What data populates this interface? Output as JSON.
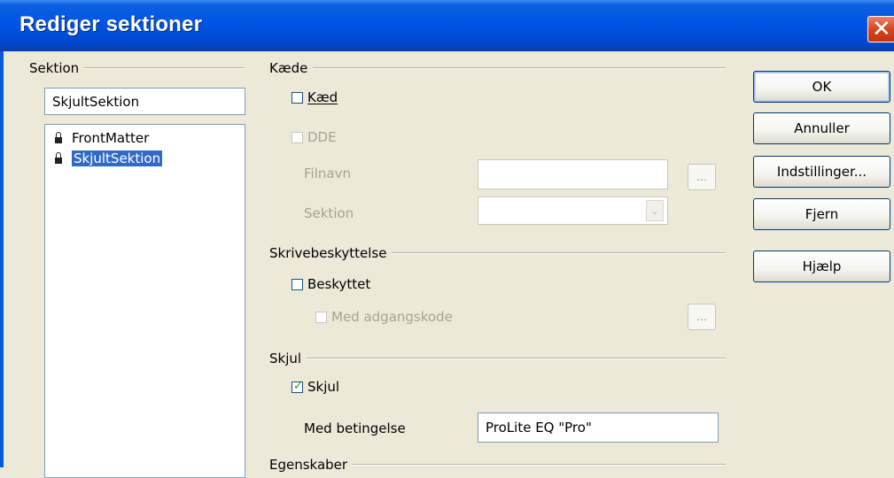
{
  "window": {
    "title": "Rediger sektioner",
    "close_glyph": "✕"
  },
  "section_group": {
    "label": "Sektion",
    "name_value": "SkjultSektion",
    "items": [
      {
        "label": "FrontMatter",
        "icon": "lock-icon",
        "selected": false
      },
      {
        "label": "SkjultSektion",
        "icon": "lock-icon",
        "selected": true
      }
    ]
  },
  "link_group": {
    "label": "Kæde",
    "link_checkbox": {
      "label": "Kæd",
      "checked": false
    },
    "dde_checkbox": {
      "label": "DDE",
      "checked": false,
      "enabled": false
    },
    "filename_label": "Filnavn",
    "filename_value": "",
    "browse_label": "...",
    "section_label": "Sektion",
    "section_value": ""
  },
  "protect_group": {
    "label": "Skrivebeskyttelse",
    "protected_checkbox": {
      "label": "Beskyttet",
      "checked": false
    },
    "password_checkbox": {
      "label": "Med adgangskode",
      "checked": false,
      "enabled": false
    },
    "password_button": "..."
  },
  "hide_group": {
    "label": "Skjul",
    "hide_checkbox": {
      "label": "Skjul",
      "checked": true
    },
    "condition_label": "Med betingelse",
    "condition_value": "ProLite EQ \"Pro\""
  },
  "properties_group": {
    "label": "Egenskaber"
  },
  "buttons": {
    "ok": "OK",
    "cancel": "Annuller",
    "options": "Indstillinger...",
    "remove": "Fjern",
    "help": "Hjælp"
  }
}
